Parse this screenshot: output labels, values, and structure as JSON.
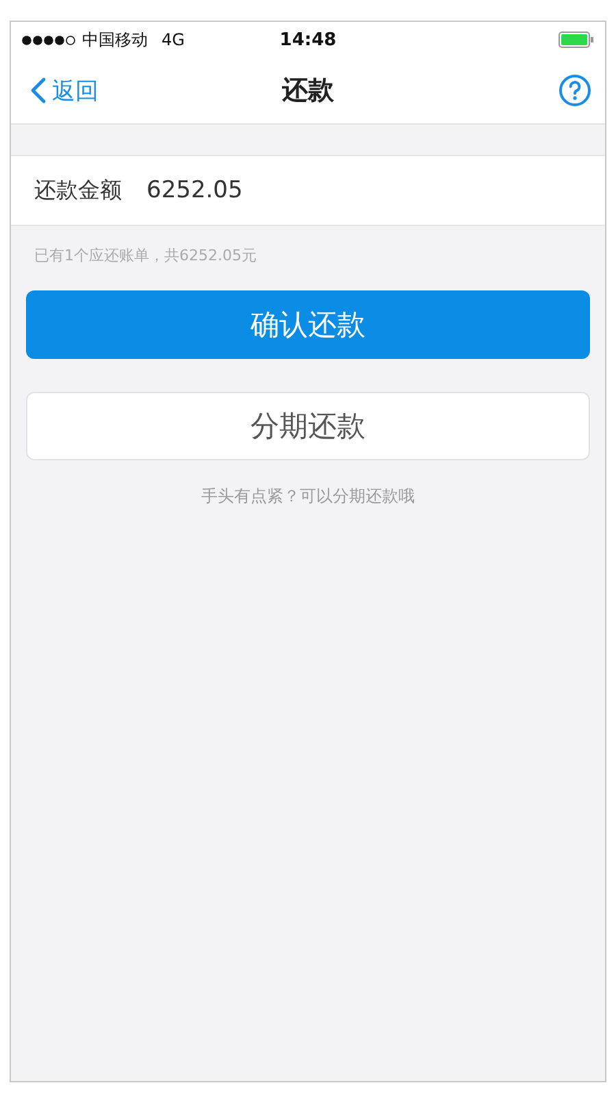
{
  "status_bar": {
    "carrier": "中国移动",
    "network": "4G",
    "time": "14:48"
  },
  "nav": {
    "back": "返回",
    "title": "还款"
  },
  "amount": {
    "label": "还款金额",
    "value": "6252.05"
  },
  "hint": "已有1个应还账单，共6252.05元",
  "buttons": [
    {
      "label": "确认还款",
      "kind": "primary"
    },
    {
      "label": "分期还款",
      "kind": "secondary"
    }
  ],
  "footer_note": "手头有点紧？可以分期还款哦"
}
